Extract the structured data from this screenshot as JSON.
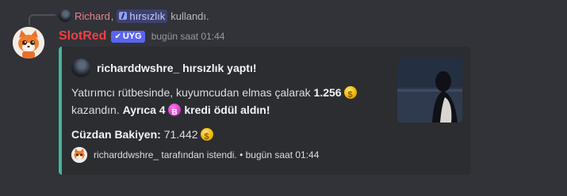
{
  "reply": {
    "user": "Richard",
    "separator": ",",
    "command": "hırsızlık",
    "action": "kullandı."
  },
  "message": {
    "username": "SlotRed",
    "badge": "UYG",
    "timestamp": "bugün saat 01:44"
  },
  "embed": {
    "accent_color": "#43b5a0",
    "author": "richarddwshre_ hırsızlık yaptı!",
    "desc_part1": "Yatırımcı rütbesinde, kuyumcudan elmas çalarak ",
    "amount": "1.256",
    "desc_part2": "kazandın. ",
    "bonus_prefix": "Ayrıca 4",
    "bonus_suffix": "kredi ödül aldın!",
    "wallet_label": "Cüzdan Bakiyen:",
    "wallet_value": "71.442",
    "footer": "richarddwshre_ tarafından istendi. • bugün saat 01:44"
  },
  "icons": {
    "coin": "gold-coin-icon",
    "credit": "pink-credit-icon",
    "badge_check": "checkmark-icon",
    "slash": "slash-command-icon"
  }
}
